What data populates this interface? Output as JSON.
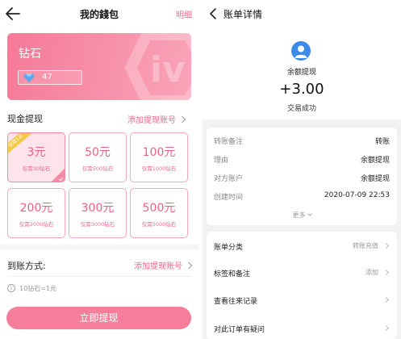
{
  "left": {
    "header": {
      "title": "我的錢包",
      "right_link": "明细"
    },
    "card": {
      "title": "钻石",
      "balance": "47"
    },
    "section": {
      "title": "现金提现",
      "link": "添加提现账号"
    },
    "options": [
      {
        "amount": "3元",
        "sub": "仅需30钻石",
        "badge": "仅限1次",
        "selected": true
      },
      {
        "amount": "50元",
        "sub": "仅需500钻石",
        "selected": false
      },
      {
        "amount": "100元",
        "sub": "仅需1000钻石",
        "selected": false
      },
      {
        "amount": "200元",
        "sub": "仅需2000钻石",
        "selected": false
      },
      {
        "amount": "300元",
        "sub": "仅需3000钻石",
        "selected": false
      },
      {
        "amount": "500元",
        "sub": "仅需5000钻石",
        "selected": false
      }
    ],
    "arrival": {
      "label": "到账方式:",
      "link": "添加提现账号"
    },
    "rate_note": "10钻石=1元",
    "submit": "立即提现",
    "colors": {
      "accent": "#f77e9b",
      "card": "#f57a98",
      "badge": "#f5c842"
    }
  },
  "right": {
    "header": {
      "title": "账单详情"
    },
    "summary": {
      "payee": "余额提现",
      "amount": "+3.00",
      "status": "交易成功"
    },
    "details": [
      {
        "key": "转账备注",
        "value": "转账"
      },
      {
        "key": "理由",
        "value": "余额提现"
      },
      {
        "key": "对方账户",
        "value": "余额提现"
      },
      {
        "key": "创建时间",
        "value": "2020-07-09 22:53"
      }
    ],
    "more": "更多",
    "actions": [
      {
        "label": "账单分类",
        "value": "转账充值"
      },
      {
        "label": "标签和备注",
        "value": "添加"
      },
      {
        "label": "查看往来记录",
        "value": ""
      },
      {
        "label": "对此订单有疑问",
        "value": ""
      }
    ],
    "colors": {
      "avatar": "#3c8be8",
      "background": "#f2f2f2"
    }
  }
}
